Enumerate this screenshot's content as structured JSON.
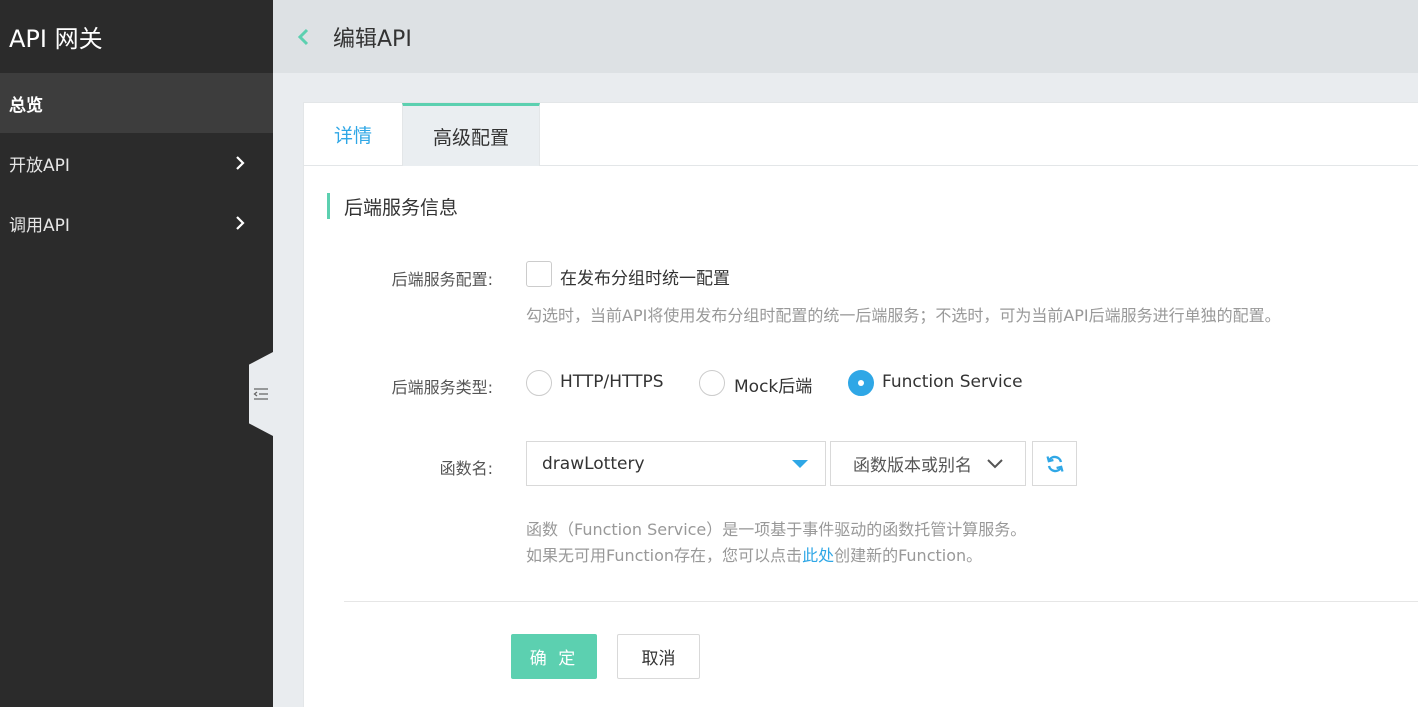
{
  "sidebar": {
    "brand": "API 网关",
    "items": [
      {
        "label": "总览"
      },
      {
        "label": "开放API"
      },
      {
        "label": "调用API"
      }
    ]
  },
  "header": {
    "title": "编辑API"
  },
  "tabs": [
    {
      "label": "详情"
    },
    {
      "label": "高级配置"
    }
  ],
  "section": {
    "title": "后端服务信息"
  },
  "form": {
    "backend_config": {
      "label": "后端服务配置:",
      "checkbox_label": "在发布分组时统一配置",
      "hint": "勾选时，当前API将使用发布分组时配置的统一后端服务；不选时，可为当前API后端服务进行单独的配置。"
    },
    "backend_type": {
      "label": "后端服务类型:",
      "options": [
        {
          "label": "HTTP/HTTPS"
        },
        {
          "label": "Mock后端"
        },
        {
          "label": "Function Service"
        }
      ],
      "selected": "Function Service"
    },
    "function_name": {
      "label": "函数名:",
      "value": "drawLottery",
      "version_placeholder": "函数版本或别名",
      "hint_line1": "函数（Function Service）是一项基于事件驱动的函数托管计算服务。",
      "hint_line2_pre": "如果无可用Function存在，您可以点击",
      "hint_link": "此处",
      "hint_line2_post": "创建新的Function。"
    }
  },
  "buttons": {
    "confirm": "确 定",
    "cancel": "取消"
  },
  "colors": {
    "accent": "#5cd0b0",
    "link": "#2fa7e6",
    "sidebar_bg": "#2b2b2b"
  }
}
